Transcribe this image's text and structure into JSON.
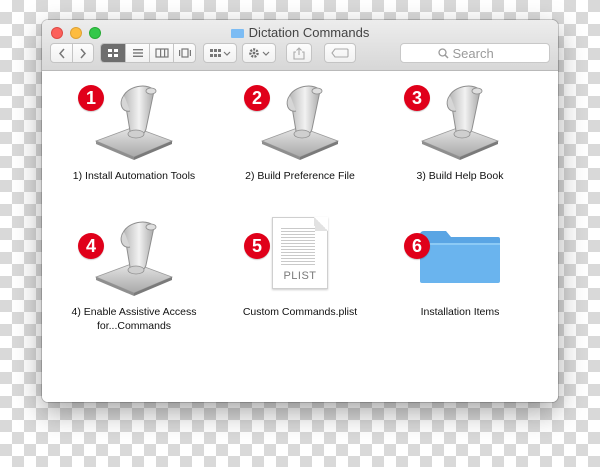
{
  "window": {
    "title": "Dictation Commands"
  },
  "toolbar": {
    "back_icon": "chevron-left-icon",
    "forward_icon": "chevron-right-icon",
    "view_modes": [
      "icon-view-icon",
      "list-view-icon",
      "column-view-icon",
      "cover-flow-icon"
    ],
    "active_view": "icon-view-icon",
    "search_placeholder": "Search"
  },
  "items": [
    {
      "num": "1",
      "label": "1) Install Automation Tools",
      "icon": "applescript-icon"
    },
    {
      "num": "2",
      "label": "2) Build Preference File",
      "icon": "applescript-icon"
    },
    {
      "num": "3",
      "label": "3) Build Help Book",
      "icon": "applescript-icon"
    },
    {
      "num": "4",
      "label": "4) Enable Assistive Access for...Commands",
      "icon": "applescript-icon"
    },
    {
      "num": "5",
      "label": "Custom Commands.plist",
      "icon": "plist-file-icon",
      "badge": "PLIST"
    },
    {
      "num": "6",
      "label": "Installation Items",
      "icon": "folder-icon"
    }
  ],
  "colors": {
    "badge": "#e0001a",
    "folder": "#6ab4ee",
    "red_light": "#fc605b",
    "yellow_light": "#fdbc40",
    "green_light": "#34c84a"
  }
}
